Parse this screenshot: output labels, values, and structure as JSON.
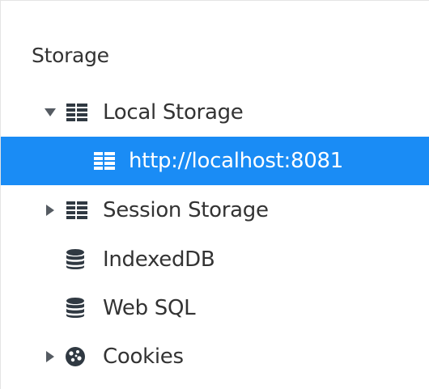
{
  "storage_panel": {
    "title": "Storage",
    "items": [
      {
        "label": "Local Storage",
        "icon": "table-grid-icon",
        "arrow": "expanded"
      },
      {
        "label": "http://localhost:8081",
        "icon": "table-grid-icon",
        "selected": true
      },
      {
        "label": "Session Storage",
        "icon": "table-grid-icon",
        "arrow": "collapsed"
      },
      {
        "label": "IndexedDB",
        "icon": "database-icon"
      },
      {
        "label": "Web SQL",
        "icon": "database-icon"
      },
      {
        "label": "Cookies",
        "icon": "cookie-icon",
        "arrow": "collapsed"
      }
    ],
    "colors": {
      "selected_background": "#1a8cf5",
      "text": "#333333",
      "icon": "#303942"
    }
  }
}
